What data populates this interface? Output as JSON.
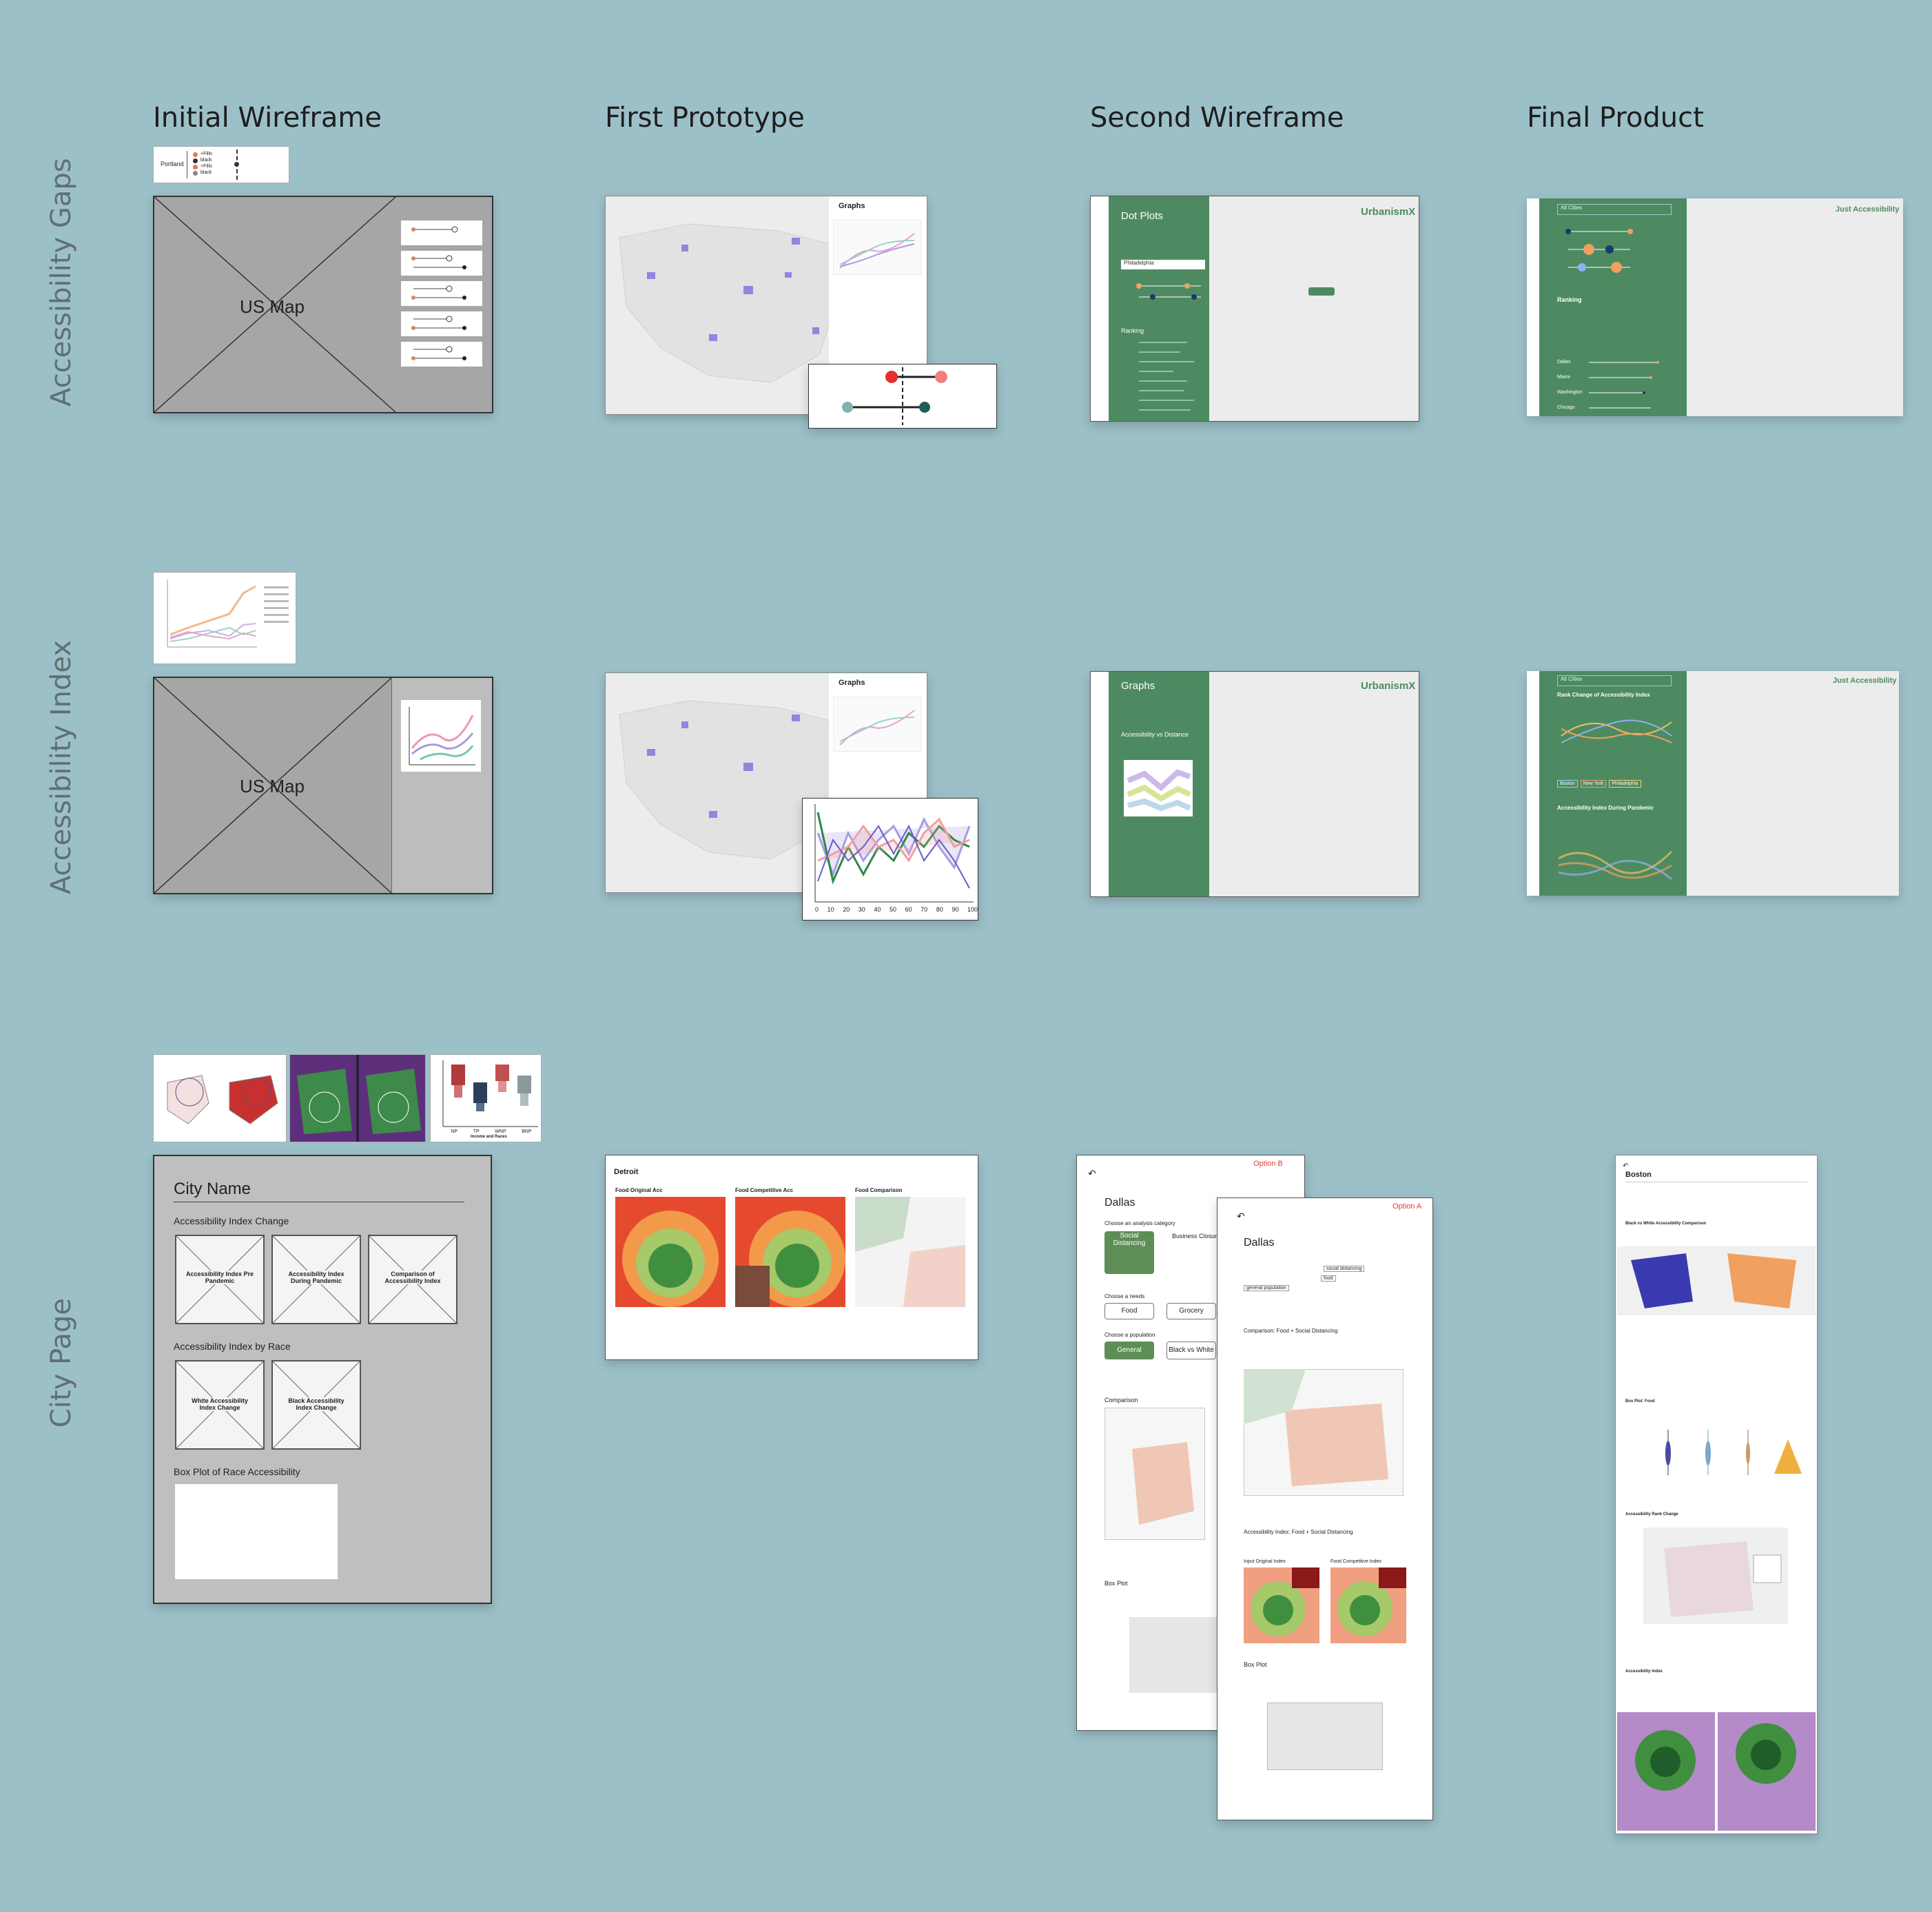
{
  "columns": [
    "Initial Wireframe",
    "First Prototype",
    "Second Wireframe",
    "Final Product"
  ],
  "rows": [
    "Accessibility Gaps",
    "Accessibility Index",
    "City Page"
  ],
  "initial_wireframe": {
    "us_map_label": "US Map",
    "city_name": "City Name",
    "index_change_heading": "Accessibility Index Change",
    "index_change_cards": [
      "Accessibility Index Pre Pandemic",
      "Accessibility Index During Pandemic",
      "Comparison of Accessibility Index"
    ],
    "by_race_heading": "Accessibility Index by Race",
    "by_race_cards": [
      "White Accessibility Index Change",
      "Black Accessibility Index Change"
    ],
    "box_plot_heading": "Box Plot of Race Accessibility",
    "legend_city": "Portland",
    "legend_items": [
      "+Fillo",
      "black",
      "+Fillo",
      "black"
    ],
    "income_axis": "Income and Races",
    "box_categories": [
      "NP",
      "TP",
      "WNP",
      "BNP"
    ]
  },
  "first_prototype": {
    "graphs_title": "Graphs",
    "city": "Detroit",
    "panels": [
      "Food Original Acc",
      "Food Competitive Acc",
      "Food Comparison"
    ],
    "x_ticks": [
      "0",
      "10",
      "20",
      "30",
      "40",
      "50",
      "60",
      "70",
      "80",
      "90",
      "100"
    ]
  },
  "second_wireframe": {
    "brand": "UrbanismX",
    "dot_plots_title": "Dot Plots",
    "ranking_label": "Ranking",
    "city_select": "Philadelphia",
    "graphs_title": "Graphs",
    "acc_vs_distance": "Accessibility vs Distance",
    "option_b": "Option B",
    "option_a": "Option A",
    "city": "Dallas",
    "choose_category": "Choose an analysis category",
    "social_distancing": "Social Distancing",
    "business_closure": "Business Closure",
    "choose_needs": "Choose a needs",
    "food": "Food",
    "grocery": "Grocery",
    "choose_population": "Choose a population",
    "general": "General",
    "black_vs_white": "Black vs White",
    "comparison": "Comparison",
    "box_plot": "Box Plot",
    "comparison_heading": "Comparison: Food + Social Distancing",
    "index_heading": "Accessibility Index: Food + Social Distancing",
    "input_original": "Input Original Index",
    "food_competitive": "Food Competitive Index",
    "dropdown_social": "social distancing",
    "dropdown_food": "food",
    "dropdown_general": "general population"
  },
  "final_product": {
    "just_accessibility": "Just Accessibility",
    "ranking_label": "Ranking",
    "rank_change": "Rank Change of Accessibility Index",
    "index_during_pandemic": "Accessibility Index During Pandemic",
    "city": "Boston",
    "select_city": "All Cities",
    "cities": [
      "Boston",
      "New York",
      "Philadelphia",
      "Washington"
    ],
    "ranking_cities": [
      "Dallas",
      "Miami",
      "Washington",
      "Chicago"
    ],
    "sections": [
      "Black vs White Accessibility Comparison",
      "Box Plot: Food",
      "Accessibility Rank Change",
      "Accessibility Index"
    ]
  },
  "colors": {
    "background": "#9cc0c8",
    "panel_green": "#4e8a61",
    "wire_gray": "#a6a6a6",
    "accent_red": "#e03c3c"
  }
}
